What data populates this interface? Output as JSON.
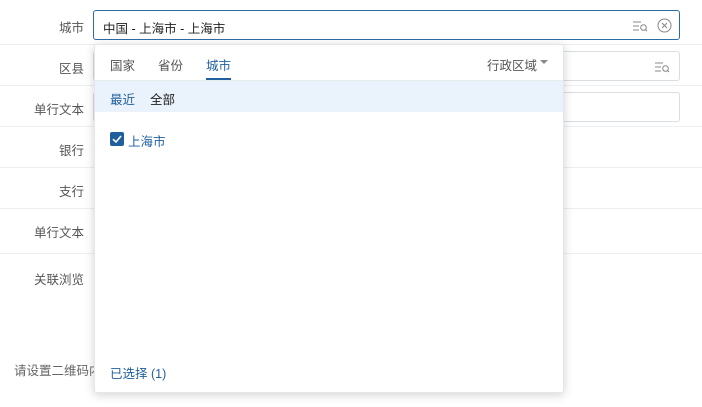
{
  "form": {
    "rows": [
      {
        "label": "城市"
      },
      {
        "label": "区县"
      },
      {
        "label": "单行文本"
      },
      {
        "label": "银行"
      },
      {
        "label": "支行"
      },
      {
        "label": "单行文本"
      },
      {
        "label": "关联浏览"
      }
    ],
    "city_field": {
      "value": "中国 - 上海市 - 上海市"
    },
    "hint_text": "请设置二维码内"
  },
  "dropdown": {
    "tabs": [
      {
        "label": "国家"
      },
      {
        "label": "省份"
      },
      {
        "label": "城市"
      }
    ],
    "active_tab": "城市",
    "region_label": "行政区域",
    "subtabs": {
      "recent": "最近",
      "all": "全部"
    },
    "options": [
      {
        "label": "上海市",
        "checked": true
      }
    ],
    "selected_count_label": "已选择 (1)"
  },
  "colors": {
    "accent": "#1f5f9e",
    "subtab_bg": "#eaf2fb"
  },
  "icons": {
    "search_list": "search-list-icon",
    "clear": "clear-circle-icon",
    "caret": "caret-down-icon",
    "check": "check-icon"
  }
}
